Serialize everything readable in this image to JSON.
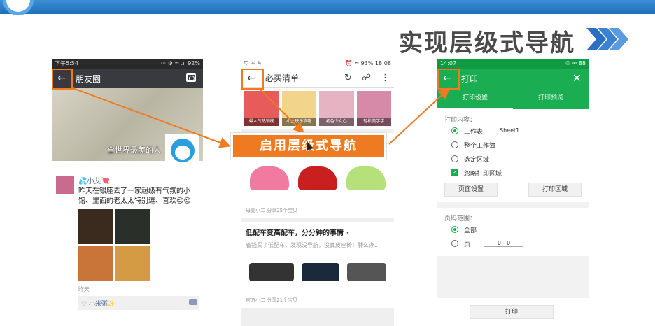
{
  "slide": {
    "title": "实现层级式导航",
    "callout_label": "启用层级式导航",
    "colors": {
      "accent": "#ee7a22",
      "header_blue": "#2a7fc9",
      "wechat_dark": "#393a3f",
      "print_green": "#1aad52"
    }
  },
  "phone1": {
    "status_time": "下午5:54",
    "status_right": "··· ⚙ ≈ .ıl 92%",
    "title": "朋友圈",
    "back_icon": "arrow-left-icon",
    "camera_icon": "camera-icon",
    "cover_caption": "全世界最美的人",
    "moment": {
      "name": "💦小艾💘",
      "text": "昨天在银座去了一家超级有气氛的小馆、里面的老太太特别逗、喜欢😍😍",
      "time": "昨天",
      "likes": "♡ 小米粥✨"
    }
  },
  "phone2": {
    "status_left": "⛉ ☼ ✎",
    "status_right": "⏰ ≈ 93% 18:08",
    "title": "必买清单",
    "refresh_icon": "refresh-icon",
    "share_icon": "share-icon",
    "more_icon": "more-vertical-icon",
    "banners": [
      "最人气热销榜",
      "小主玩乐攻略",
      "初色少女心",
      "轻松美学学"
    ],
    "card1_meta": "母婴小二 分享25个宝贝",
    "card2": {
      "title": "低配车变高配车，分分钟的事情 ›",
      "desc": "省钱买了低配车，发现没导航，没真皮座椅！肿么办...",
      "meta": "官方小二 分享21个宝贝"
    }
  },
  "phone3": {
    "status_time": "14:07",
    "status_right": "⚇ ✉ 88",
    "title": "打印",
    "close_icon": "close-icon",
    "tabs": [
      "打印设置",
      "打印预览"
    ],
    "print_content_label": "打印内容：",
    "options": [
      "工作表",
      "整个工作簿",
      "选定区域"
    ],
    "sheet_value": "Sheet1",
    "ignore_area": "忽略打印区域",
    "btn_page_setup": "页面设置",
    "btn_print_area": "打印区域",
    "page_range_label": "页码范围：",
    "range_all": "全部",
    "range_pages": "页",
    "page_value": "0—0",
    "print_button": "打印"
  }
}
